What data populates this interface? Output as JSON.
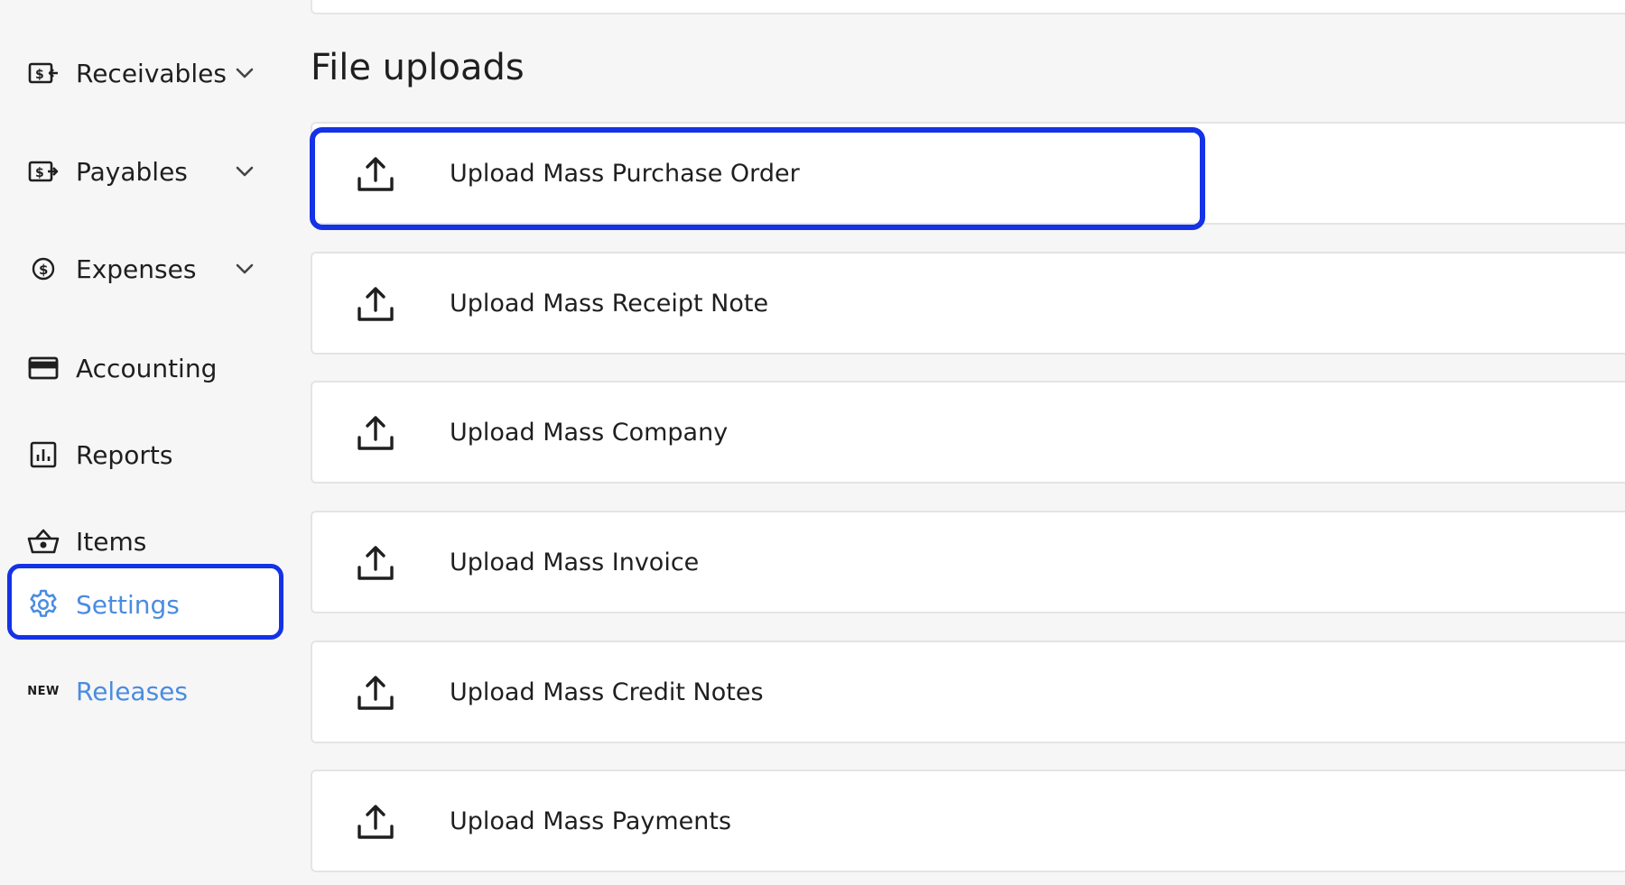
{
  "sidebar": {
    "items": [
      {
        "label": "Receivables",
        "icon": "receivables-icon",
        "has_chevron": true
      },
      {
        "label": "Payables",
        "icon": "payables-icon",
        "has_chevron": true
      },
      {
        "label": "Expenses",
        "icon": "dollar-circle-icon",
        "has_chevron": true
      },
      {
        "label": "Accounting",
        "icon": "credit-card-icon",
        "has_chevron": false
      },
      {
        "label": "Reports",
        "icon": "bar-chart-icon",
        "has_chevron": false
      },
      {
        "label": "Items",
        "icon": "basket-icon",
        "has_chevron": false
      },
      {
        "label": "Settings",
        "icon": "gear-icon",
        "has_chevron": false,
        "active": true
      },
      {
        "label": "Releases",
        "icon": "new-badge",
        "badge": "NEW",
        "has_chevron": false
      }
    ]
  },
  "main": {
    "title": "File uploads",
    "uploads": [
      {
        "label": "Upload Mass Purchase Order"
      },
      {
        "label": "Upload Mass Receipt Note"
      },
      {
        "label": "Upload Mass Company"
      },
      {
        "label": "Upload Mass Invoice"
      },
      {
        "label": "Upload Mass Credit Notes"
      },
      {
        "label": "Upload Mass Payments"
      }
    ]
  },
  "colors": {
    "accent": "#4a8ce0",
    "highlight": "#1432e6",
    "background": "#f6f6f6",
    "card": "#ffffff"
  }
}
